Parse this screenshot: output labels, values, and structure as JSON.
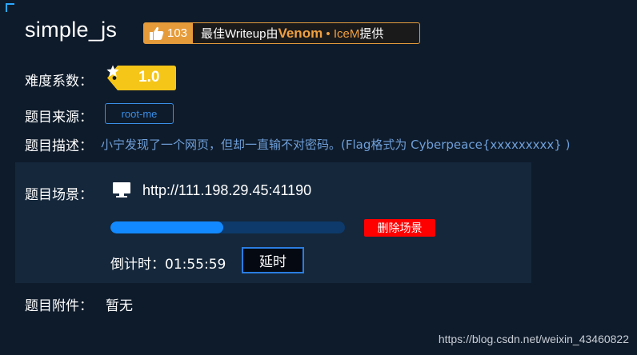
{
  "challenge": {
    "title": "simple_js",
    "writeup": {
      "likes": "103",
      "prefix": "最佳Writeup由",
      "author": "Venom",
      "separator": "•",
      "coauthor": "IceM",
      "suffix": "提供"
    },
    "difficulty": {
      "label": "难度系数：",
      "value": "1.0"
    },
    "source": {
      "label": "题目来源：",
      "value": "root-me"
    },
    "description": {
      "label": "题目描述：",
      "value": "小宁发现了一个网页，但却一直输不对密码。(Flag格式为 Cyberpeace{xxxxxxxxx} )"
    },
    "scene": {
      "label": "题目场景：",
      "url": "http://111.198.29.45:41190",
      "progress_percent": 48,
      "delete_label": "删除场景",
      "countdown_label": "倒计时：",
      "countdown_value": "01:55:59",
      "extend_label": "延时"
    },
    "attachment": {
      "label": "题目附件：",
      "value": "暂无"
    }
  },
  "watermark": "https://blog.csdn.net/weixin_43460822",
  "colors": {
    "background": "#0e1b2b",
    "panel": "#15273b",
    "accent_orange": "#e69b3a",
    "accent_blue": "#1389ff",
    "link_blue": "#3a8ee6",
    "danger": "#ff0000",
    "difficulty_badge": "#f5c518"
  },
  "icons": [
    "thumbs-up-icon",
    "star-icon",
    "monitor-icon"
  ]
}
